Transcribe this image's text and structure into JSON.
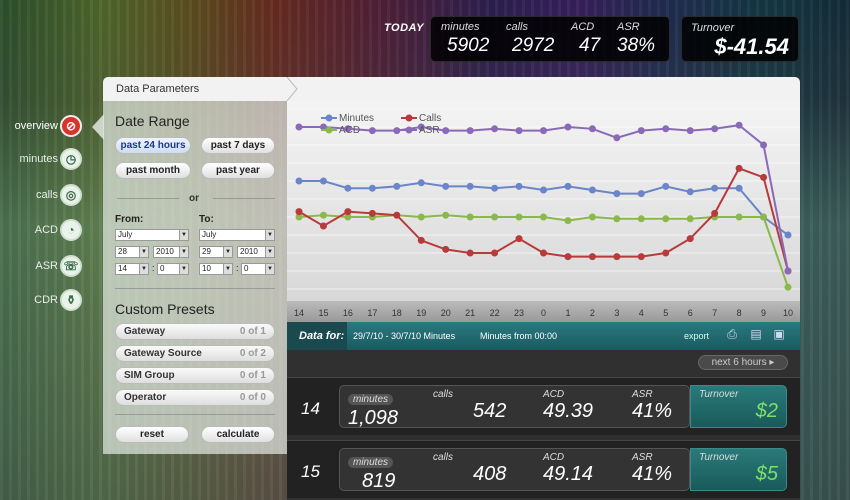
{
  "today": {
    "label": "TODAY",
    "minutes_label": "minutes",
    "minutes": "5902",
    "calls_label": "calls",
    "calls": "2972",
    "acd_label": "ACD",
    "acd": "47",
    "asr_label": "ASR",
    "asr": "38%"
  },
  "turnover": {
    "label": "Turnover",
    "value": "$-41.54"
  },
  "nav": [
    {
      "label": "overview",
      "icon": "chart-icon",
      "active": true
    },
    {
      "label": "minutes",
      "icon": "clock-icon"
    },
    {
      "label": "calls",
      "icon": "target-icon"
    },
    {
      "label": "ACD",
      "icon": "gauge-icon"
    },
    {
      "label": "ASR",
      "icon": "phone-icon"
    },
    {
      "label": "CDR",
      "icon": "bottle-icon"
    }
  ],
  "panel": {
    "title": "Data Parameters"
  },
  "date_range": {
    "title": "Date Range",
    "btn_24h": "past 24 hours",
    "btn_7d": "past 7 days",
    "btn_month": "past month",
    "btn_year": "past year",
    "or": "or",
    "from_label": "From:",
    "to_label": "To:",
    "from": {
      "month": "July",
      "day": "28",
      "year": "2010",
      "hour": "14",
      "min": "0"
    },
    "to": {
      "month": "July",
      "day": "29",
      "year": "2010",
      "hour": "10",
      "min": "0"
    }
  },
  "presets": {
    "title": "Custom Presets",
    "items": [
      {
        "name": "Gateway",
        "count": "0 of 1"
      },
      {
        "name": "Gateway Source",
        "count": "0 of 2"
      },
      {
        "name": "SIM Group",
        "count": "0 of 1"
      },
      {
        "name": "Operator",
        "count": "0 of 0"
      }
    ],
    "reset": "reset",
    "calculate": "calculate"
  },
  "chart_data": {
    "type": "line",
    "categories": [
      "14",
      "15",
      "16",
      "17",
      "18",
      "19",
      "20",
      "21",
      "22",
      "23",
      "0",
      "1",
      "2",
      "3",
      "4",
      "5",
      "6",
      "7",
      "8",
      "9",
      "10"
    ],
    "series": [
      {
        "name": "Minutes",
        "color": "#6a86c8",
        "values": [
          60,
          60,
          56,
          56,
          57,
          59,
          57,
          57,
          56,
          57,
          55,
          57,
          55,
          53,
          53,
          57,
          54,
          56,
          56,
          40,
          30
        ]
      },
      {
        "name": "ACD",
        "color": "#8ab84a",
        "values": [
          40,
          41,
          40,
          40,
          41,
          40,
          41,
          40,
          40,
          40,
          40,
          38,
          40,
          39,
          39,
          39,
          39,
          40,
          40,
          40,
          1
        ]
      },
      {
        "name": "Calls",
        "color": "#b83a3a",
        "values": [
          43,
          35,
          43,
          42,
          41,
          27,
          22,
          20,
          20,
          28,
          20,
          18,
          18,
          18,
          18,
          20,
          28,
          42,
          67,
          62,
          10
        ]
      },
      {
        "name": "ASR",
        "color": "#8a6ab8",
        "values": [
          90,
          90,
          89,
          88,
          88,
          90,
          88,
          88,
          89,
          88,
          88,
          90,
          89,
          84,
          88,
          89,
          88,
          89,
          91,
          80,
          10
        ]
      }
    ],
    "ylim": [
      0,
      100
    ],
    "grid": true,
    "legend": "top-left"
  },
  "data_bar": {
    "for_label": "Data for:",
    "range": "29/7/10 - 30/7/10 Minutes",
    "from": "Minutes from 00:00",
    "export": "export"
  },
  "table": {
    "next_label": "next 6 hours",
    "rows": [
      {
        "hour": "14",
        "minutes": "1,098",
        "calls": "542",
        "acd": "49.39",
        "asr": "41%",
        "turnover": "$2"
      },
      {
        "hour": "15",
        "minutes": "819",
        "calls": "408",
        "acd": "49.14",
        "asr": "41%",
        "turnover": "$5"
      }
    ],
    "labels": {
      "minutes": "minutes",
      "calls": "calls",
      "acd": "ACD",
      "asr": "ASR",
      "turnover": "Turnover"
    }
  }
}
